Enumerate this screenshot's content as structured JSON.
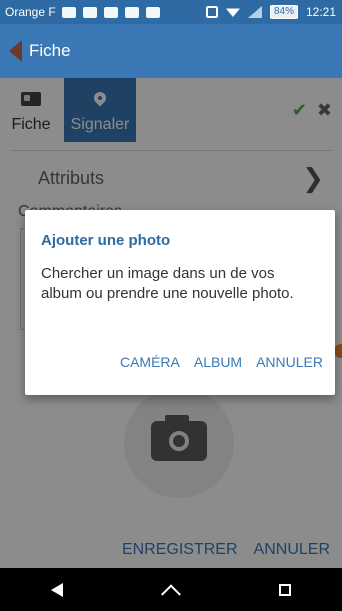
{
  "status_bar": {
    "carrier": "Orange F",
    "battery": "84%",
    "time": "12:21"
  },
  "app_bar": {
    "title": "Fiche"
  },
  "tabs": [
    {
      "label": "Fiche",
      "icon": "card-icon",
      "selected": false
    },
    {
      "label": "Signaler",
      "icon": "pin-icon",
      "selected": true
    }
  ],
  "toolbar": {
    "confirm_icon": "check-icon",
    "close_icon": "close-icon"
  },
  "form": {
    "attributs_label": "Attributs",
    "commentaires_label": "Commentaires"
  },
  "dialog": {
    "title": "Ajouter une photo",
    "message": "Chercher un image dans un de vos album ou prendre une nouvelle photo.",
    "buttons": {
      "camera": "CAMÉRA",
      "album": "ALBUM",
      "cancel": "ANNULER"
    }
  },
  "bottom_actions": {
    "save": "ENREGISTRER",
    "cancel": "ANNULER"
  },
  "colors": {
    "primary": "#3a79b6",
    "status_bar": "#2e6aa3",
    "accent_check": "#4caf50",
    "accent_orange": "#f58a2c"
  }
}
